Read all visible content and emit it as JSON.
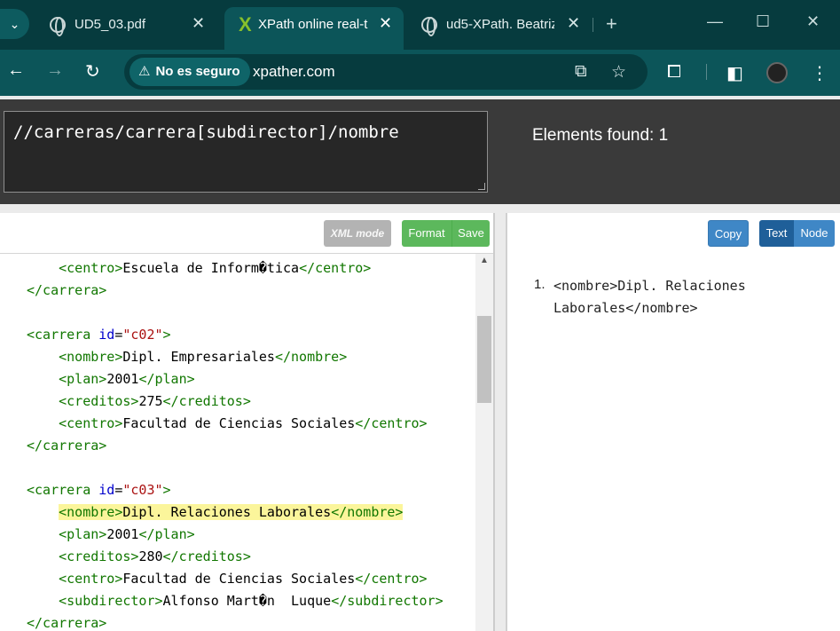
{
  "browser": {
    "tabs": [
      {
        "title": "UD5_03.pdf",
        "icon": "globe-icon",
        "active": false
      },
      {
        "title": "XPath online real-t",
        "icon": "xpather-logo-icon",
        "active": true
      },
      {
        "title": "ud5-XPath. Beatriz",
        "icon": "globe-icon",
        "active": false
      }
    ],
    "security_label": "No es seguro",
    "url": "xpather.com"
  },
  "query": {
    "expression": "//carreras/carrera[subdirector]/nombre",
    "elements_found_label": "Elements found: 1"
  },
  "editor": {
    "buttons": {
      "xml_mode": "XML mode",
      "format": "Format",
      "save": "Save"
    },
    "lines": [
      {
        "indent": "    ",
        "open": "<centro>",
        "text": "Escuela de Inform�tica",
        "close": "</centro>"
      },
      {
        "indent": "",
        "open": "</carrera>",
        "text": "",
        "close": ""
      },
      {
        "indent": "",
        "open": "",
        "text": "",
        "close": ""
      },
      {
        "indent": "",
        "open": "<carrera ",
        "attr": "id",
        "value": "\"c02\"",
        "open_end": ">",
        "text": "",
        "close": ""
      },
      {
        "indent": "    ",
        "open": "<nombre>",
        "text": "Dipl. Empresariales",
        "close": "</nombre>"
      },
      {
        "indent": "    ",
        "open": "<plan>",
        "text": "2001",
        "close": "</plan>"
      },
      {
        "indent": "    ",
        "open": "<creditos>",
        "text": "275",
        "close": "</creditos>"
      },
      {
        "indent": "    ",
        "open": "<centro>",
        "text": "Facultad de Ciencias Sociales",
        "close": "</centro>"
      },
      {
        "indent": "",
        "open": "</carrera>",
        "text": "",
        "close": ""
      },
      {
        "indent": "",
        "open": "",
        "text": "",
        "close": ""
      },
      {
        "indent": "",
        "open": "<carrera ",
        "attr": "id",
        "value": "\"c03\"",
        "open_end": ">",
        "text": "",
        "close": ""
      },
      {
        "indent": "    ",
        "open": "<nombre>",
        "text": "Dipl. Relaciones Laborales",
        "close": "</nombre>",
        "highlight": true
      },
      {
        "indent": "    ",
        "open": "<plan>",
        "text": "2001",
        "close": "</plan>"
      },
      {
        "indent": "    ",
        "open": "<creditos>",
        "text": "280",
        "close": "</creditos>"
      },
      {
        "indent": "    ",
        "open": "<centro>",
        "text": "Facultad de Ciencias Sociales",
        "close": "</centro>"
      },
      {
        "indent": "    ",
        "open": "<subdirector>",
        "text": "Alfonso Mart�n  Luque",
        "close": "</subdirector>"
      },
      {
        "indent": "",
        "open": "</carrera>",
        "text": "",
        "close": ""
      }
    ],
    "scroll_position": 0.33
  },
  "results": {
    "buttons": {
      "copy": "Copy",
      "text": "Text",
      "node": "Node"
    },
    "items": [
      {
        "number": "1.",
        "value": "<nombre>Dipl. Relaciones Laborales</nombre>"
      }
    ]
  }
}
